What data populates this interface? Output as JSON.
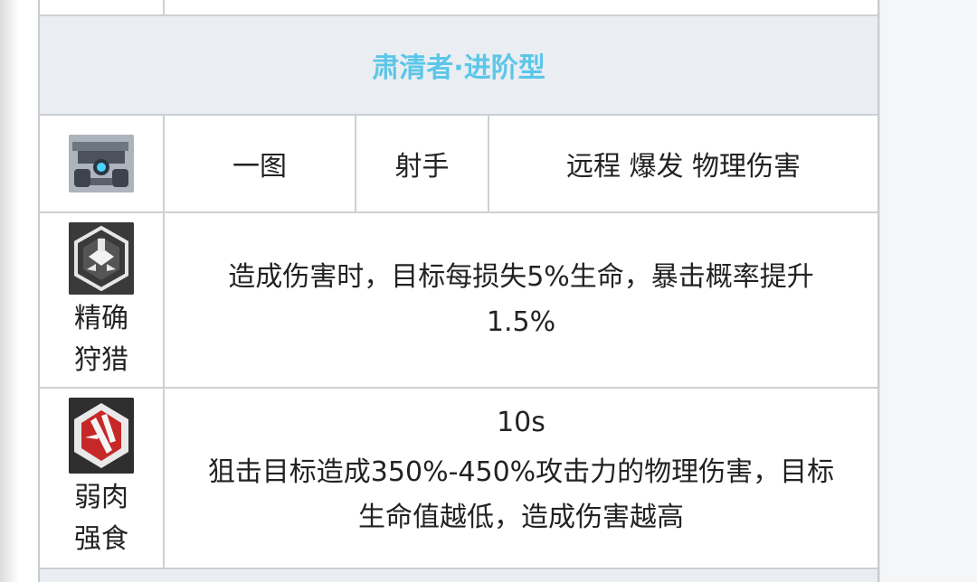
{
  "header": {
    "title": "肃清者·进阶型"
  },
  "info_row": {
    "icon": "turret-robot-icon",
    "cells": [
      "一图",
      "射手",
      "远程 爆发 物理伤害"
    ]
  },
  "skills": [
    {
      "icon": "precision-hunt-icon",
      "name": "精确\n狩猎",
      "cooldown": "",
      "description": "造成伤害时，目标每损失5%生命，暴击概率提升 1.5%"
    },
    {
      "icon": "predator-strike-icon",
      "name": "弱肉\n强食",
      "cooldown": "10s",
      "description": "狙击目标造成350%-450%攻击力的物理伤害，目标生命值越低，造成伤害越高"
    }
  ],
  "colors": {
    "header_text": "#5bc6e8",
    "header_bg": "#eaeef2",
    "border": "#cdd0d3"
  }
}
